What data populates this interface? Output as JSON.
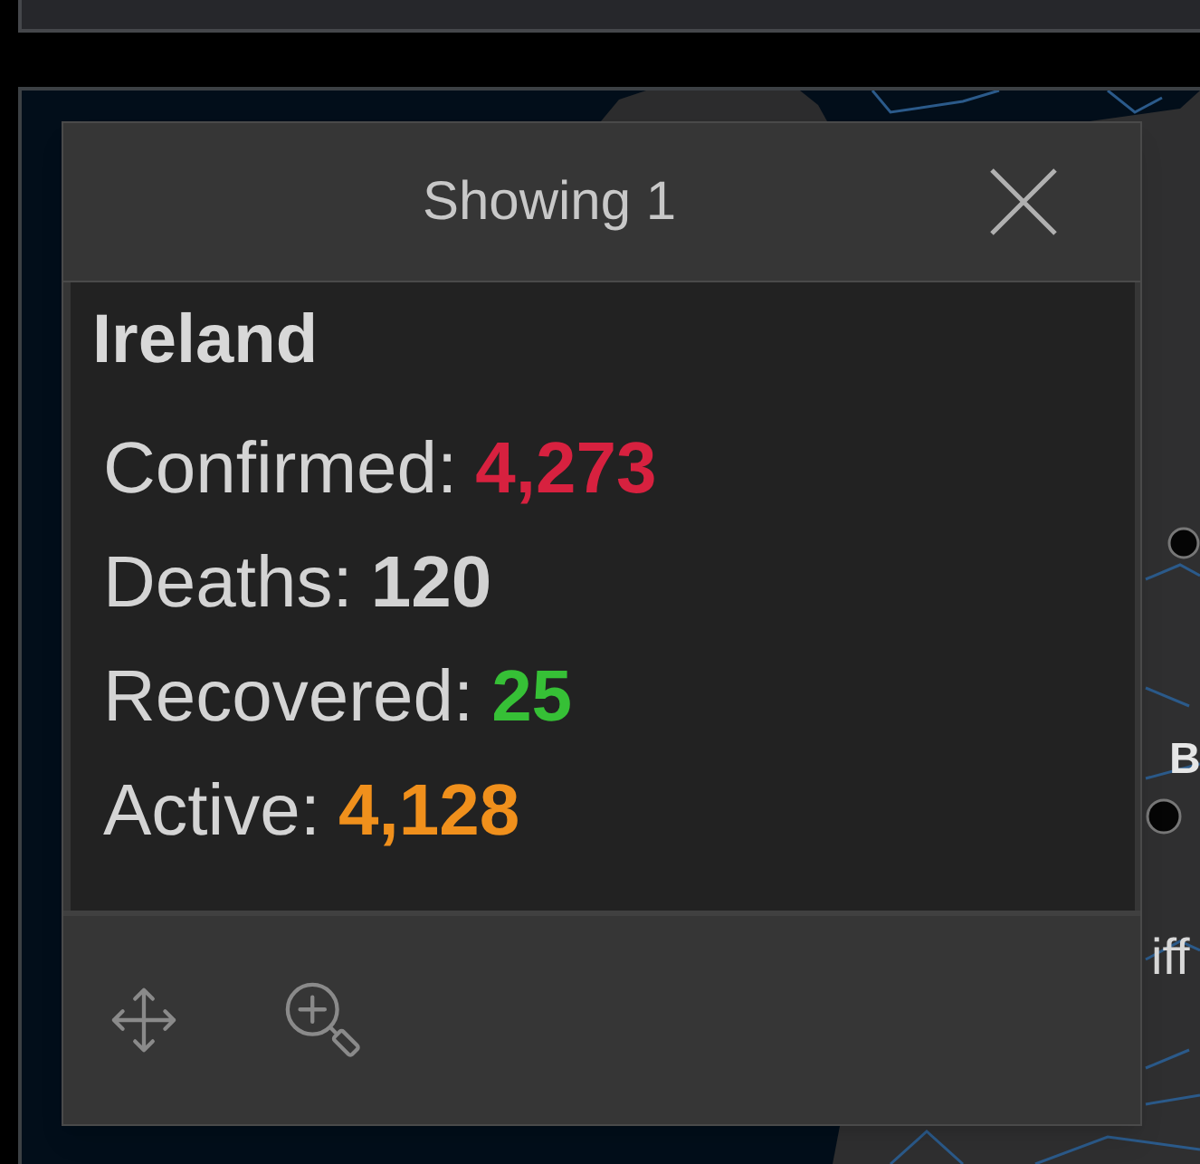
{
  "popup": {
    "title": "Showing 1",
    "heading": "Ireland",
    "stats": [
      {
        "label": "Confirmed:",
        "value": "4,273",
        "color": "#d7213f"
      },
      {
        "label": "Deaths:",
        "value": "120",
        "color": "#d2d2d2"
      },
      {
        "label": "Recovered:",
        "value": "25",
        "color": "#36c036"
      },
      {
        "label": "Active:",
        "value": "4,128",
        "color": "#f0901c"
      }
    ]
  },
  "map": {
    "labels": [
      "B",
      "iff"
    ]
  }
}
